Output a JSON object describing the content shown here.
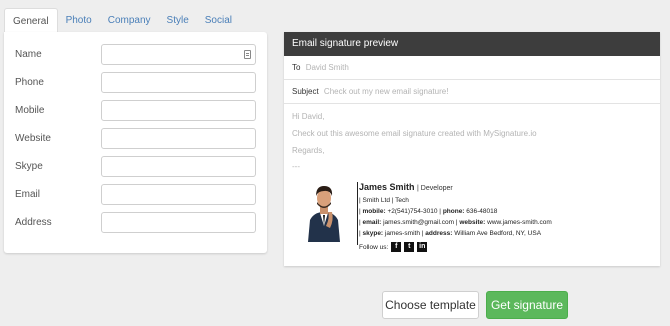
{
  "tabs": [
    "General",
    "Photo",
    "Company",
    "Style",
    "Social"
  ],
  "form": {
    "fields": [
      {
        "label": "Name",
        "value": ""
      },
      {
        "label": "Phone",
        "value": ""
      },
      {
        "label": "Mobile",
        "value": ""
      },
      {
        "label": "Website",
        "value": ""
      },
      {
        "label": "Skype",
        "value": ""
      },
      {
        "label": "Email",
        "value": ""
      },
      {
        "label": "Address",
        "value": ""
      }
    ]
  },
  "preview": {
    "title": "Email signature preview",
    "to_label": "To",
    "to_value": "David Smith",
    "subject_label": "Subject",
    "subject_value": "Check out my new email signature!",
    "greeting": "Hi David,",
    "message": "Check out this awesome email signature created with MySignature.io",
    "regards": "Regards,",
    "dashes": "---"
  },
  "signature": {
    "name": "James Smith",
    "role": "| Developer",
    "company_line": "| Smith Ltd | Tech",
    "mobile_label": "mobile:",
    "mobile": "+2(541)754-3010",
    "phone_label": "phone:",
    "phone": "636-48018",
    "email_label": "email:",
    "email": "james.smith@gmail.com",
    "website_label": "website:",
    "website": "www.james-smith.com",
    "skype_label": "skype:",
    "skype": "james-smith",
    "address_label": "address:",
    "address": "William Ave Bedford, NY, USA",
    "follow_label": "Follow us:",
    "social": [
      "f",
      "t",
      "in"
    ]
  },
  "buttons": {
    "choose_template": "Choose template",
    "get_signature": "Get signature"
  },
  "colors": {
    "accent_tab": "#4a7fb8",
    "header_bg": "#3d3d3d",
    "primary_button": "#5cb85c"
  }
}
